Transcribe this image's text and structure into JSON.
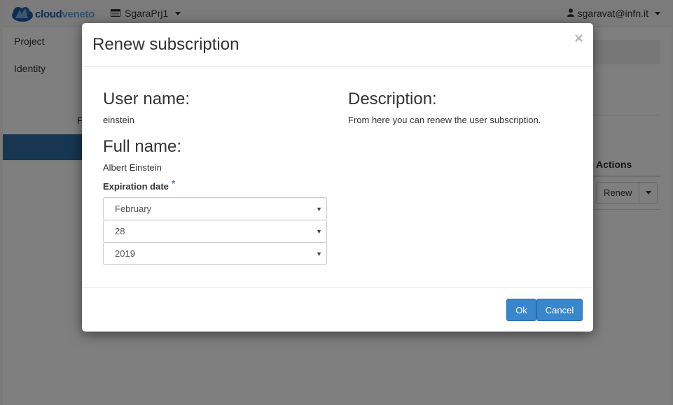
{
  "topbar": {
    "logo_text_bold": "cloud",
    "logo_text_light": "veneto",
    "project_name": "SgaraPrj1",
    "user_name": "sgaravat@infn.it"
  },
  "sidebar": {
    "items": [
      {
        "label": "Project"
      },
      {
        "label": "Identity"
      }
    ],
    "sub_label": "P"
  },
  "background_table": {
    "actions_header": "Actions",
    "row_action_label": "Renew"
  },
  "modal": {
    "title": "Renew subscription",
    "close_glyph": "×",
    "user_name_label": "User name:",
    "user_name_value": "einstein",
    "full_name_label": "Full name:",
    "full_name_value": "Albert Einstein",
    "expiration_label": "Expiration date",
    "required_mark": "*",
    "month": "February",
    "day": "28",
    "year": "2019",
    "description_label": "Description:",
    "description_text": "From here you can renew the user subscription.",
    "ok_label": "Ok",
    "cancel_label": "Cancel"
  },
  "colors": {
    "primary": "#3a86cc",
    "sidebar_active": "#2d6ca2",
    "required": "#3a8ed4"
  }
}
